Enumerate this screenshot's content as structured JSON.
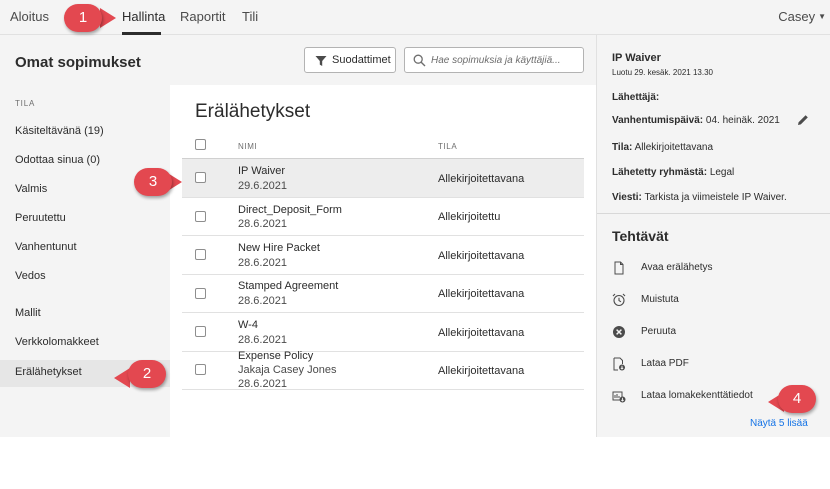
{
  "topnav": {
    "items": [
      "Aloitus",
      "Hallinta",
      "Raportit",
      "Tili"
    ],
    "active": "Hallinta",
    "user": "Casey"
  },
  "sidebar": {
    "title": "Omat sopimukset",
    "section": "TILA",
    "items": [
      "Käsiteltävänä (19)",
      "Odottaa sinua (0)",
      "Valmis",
      "Peruutettu",
      "Vanhentunut",
      "Vedos",
      "Mallit",
      "Verkkolomakkeet",
      "Erälähetykset"
    ],
    "selected": "Erälähetykset"
  },
  "toolbar": {
    "filter_label": "Suodattimet",
    "search_placeholder": "Hae sopimuksia ja käyttäjiä..."
  },
  "main": {
    "title": "Erälähetykset",
    "columns": [
      "NIMI",
      "TILA"
    ],
    "rows": [
      {
        "name": "IP Waiver",
        "date": "29.6.2021",
        "status": "Allekirjoitettavana"
      },
      {
        "name": "Direct_Deposit_Form",
        "date": "28.6.2021",
        "status": "Allekirjoitettu"
      },
      {
        "name": "New Hire Packet",
        "date": "28.6.2021",
        "status": "Allekirjoitettavana"
      },
      {
        "name": "Stamped Agreement",
        "date": "28.6.2021",
        "status": "Allekirjoitettavana"
      },
      {
        "name": "W-4",
        "date": "28.6.2021",
        "status": "Allekirjoitettavana"
      },
      {
        "name": "Expense Policy",
        "sender": "Jakaja Casey Jones",
        "date": "28.6.2021",
        "status": "Allekirjoitettavana"
      }
    ]
  },
  "details": {
    "title": "IP Waiver",
    "created": "Luotu 29. kesäk. 2021 13.30",
    "sender_label": "Lähettäjä:",
    "expiry_label": "Vanhentumispäivä:",
    "expiry_value": "04. heinäk. 2021",
    "status_label": "Tila:",
    "status_value": "Allekirjoitettavana",
    "group_label": "Lähetetty ryhmästä:",
    "group_value": "Legal",
    "message_label": "Viesti:",
    "message_value": "Tarkista ja viimeistele IP Waiver."
  },
  "tasks": {
    "title": "Tehtävät",
    "items": [
      {
        "label": "Avaa erälähetys",
        "icon": "document-icon"
      },
      {
        "label": "Muistuta",
        "icon": "alarm-clock-icon"
      },
      {
        "label": "Peruuta",
        "icon": "cancel-circle-icon"
      },
      {
        "label": "Lataa PDF",
        "icon": "download-pdf-icon"
      },
      {
        "label": "Lataa lomakekenttätiedot",
        "icon": "download-data-icon"
      }
    ],
    "show_more": "Näytä 5 lisää"
  },
  "callouts": [
    "1",
    "2",
    "3",
    "4"
  ],
  "colors": {
    "callout": "#e34850",
    "link": "#1473e6",
    "panel_bg": "#f4f4f4"
  }
}
